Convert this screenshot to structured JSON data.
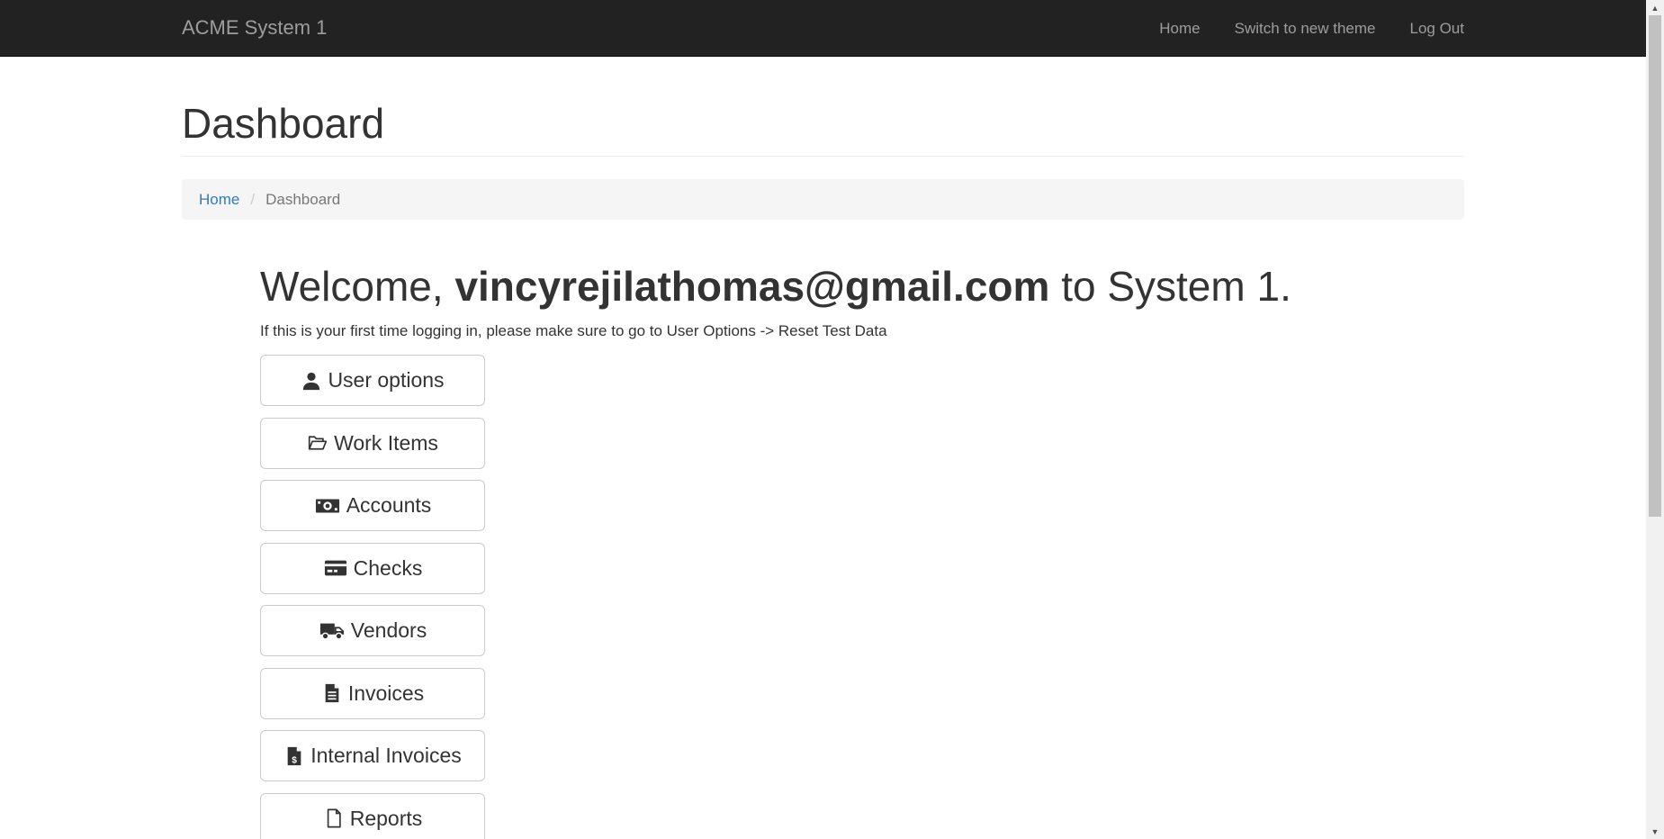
{
  "navbar": {
    "brand": "ACME System 1",
    "links": [
      {
        "label": "Home"
      },
      {
        "label": "Switch to new theme"
      },
      {
        "label": "Log Out"
      }
    ]
  },
  "page": {
    "title": "Dashboard"
  },
  "breadcrumb": {
    "home": "Home",
    "current": "Dashboard"
  },
  "welcome": {
    "prefix": "Welcome, ",
    "email": "vincyrejilathomas@gmail.com",
    "suffix": " to System 1.",
    "hint": "If this is your first time logging in, please make sure to go to User Options -> Reset Test Data"
  },
  "menu": [
    {
      "label": "User options",
      "icon": "user-icon"
    },
    {
      "label": "Work Items",
      "icon": "folder-open-icon"
    },
    {
      "label": "Accounts",
      "icon": "money-icon"
    },
    {
      "label": "Checks",
      "icon": "credit-card-icon"
    },
    {
      "label": "Vendors",
      "icon": "truck-icon"
    },
    {
      "label": "Invoices",
      "icon": "file-text-icon"
    },
    {
      "label": "Internal Invoices",
      "icon": "file-invoice-dollar-icon"
    },
    {
      "label": "Reports",
      "icon": "file-icon"
    }
  ],
  "colors": {
    "navbar_bg": "#222222",
    "nav_text": "#9d9d9d",
    "link": "#337ab7",
    "breadcrumb_bg": "#f5f5f5"
  }
}
